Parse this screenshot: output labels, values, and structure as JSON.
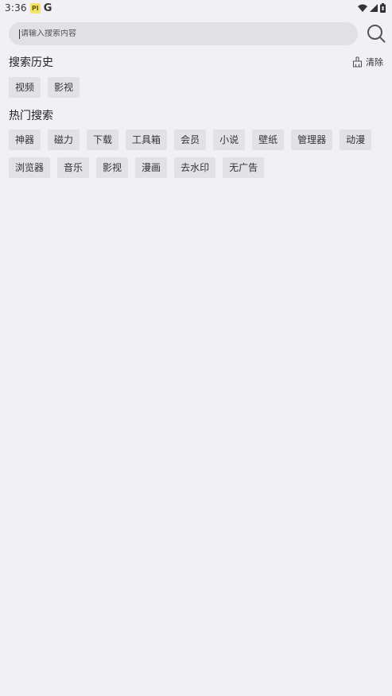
{
  "status_bar": {
    "time": "3:36",
    "notif_badge": "PI",
    "g_icon": "G",
    "icons": [
      "wifi-icon",
      "signal-icon",
      "battery-icon"
    ]
  },
  "search": {
    "placeholder": "请输入搜索内容",
    "value": ""
  },
  "history": {
    "title": "搜索历史",
    "clear_label": "清除",
    "items": [
      "视频",
      "影视"
    ]
  },
  "hot": {
    "title": "热门搜索",
    "row1": [
      "神器",
      "磁力",
      "下载",
      "工具箱",
      "会员",
      "小说",
      "壁纸",
      "管理器",
      "动漫"
    ],
    "row2": [
      "浏览器",
      "音乐",
      "影视",
      "漫画",
      "去水印",
      "无广告"
    ]
  },
  "colors": {
    "background": "#f1f0f5",
    "chip": "#e2e1e6",
    "search_box": "#e1e0e5"
  }
}
